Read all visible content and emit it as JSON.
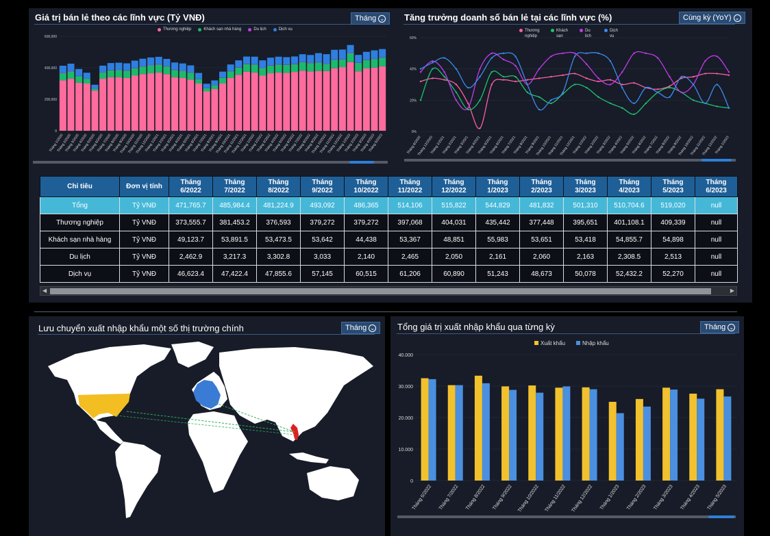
{
  "panel1": {
    "title": "Giá trị bán lẻ theo các lĩnh vực (Tỷ VNĐ)",
    "dropdown": "Tháng",
    "legend": [
      "Thương nghiệp",
      "Khách sạn nhà hàng",
      "Du lịch",
      "Dịch vụ"
    ],
    "colors": [
      "#ff6b9d",
      "#1db96b",
      "#c13fe0",
      "#2f7fe0"
    ]
  },
  "panel2": {
    "title": "Tăng trưởng doanh số bán lẻ tại các lĩnh vực (%)",
    "dropdown": "Cùng kỳ (YoY)",
    "legend": [
      "Thương nghiệp",
      "Khách sạn",
      "Du lịch",
      "Dịch vụ"
    ],
    "colors": [
      "#ff5fa2",
      "#1fc36d",
      "#c33bea",
      "#3d8cf0"
    ]
  },
  "table": {
    "headers": [
      "Chỉ tiêu",
      "Đơn vị tính",
      "Tháng 6/2022",
      "Tháng 7/2022",
      "Tháng 8/2022",
      "Tháng 9/2022",
      "Tháng 10/2022",
      "Tháng 11/2022",
      "Tháng 12/2022",
      "Tháng 1/2023",
      "Tháng 2/2023",
      "Tháng 3/2023",
      "Tháng 4/2023",
      "Tháng 5/2023",
      "Tháng 6/2023"
    ],
    "rows": [
      [
        "Tổng",
        "Tỷ VNĐ",
        "471,765.7",
        "485,984.4",
        "481,224.9",
        "493,092",
        "486,365",
        "514,106",
        "515,822",
        "544,829",
        "481,832",
        "501,310",
        "510,704.6",
        "519,020",
        "null"
      ],
      [
        "Thương nghiệp",
        "Tỷ VNĐ",
        "373,555.7",
        "381,453.2",
        "376,593",
        "379,272",
        "379,272",
        "397,068",
        "404,031",
        "435,442",
        "377,448",
        "395,651",
        "401,108.1",
        "409,339",
        "null"
      ],
      [
        "Khách sạn nhà hàng",
        "Tỷ VNĐ",
        "49,123.7",
        "53,891.5",
        "53,473.5",
        "53,642",
        "44,438",
        "53,367",
        "48,851",
        "55,983",
        "53,651",
        "53,418",
        "54,855.7",
        "54,898",
        "null"
      ],
      [
        "Du lịch",
        "Tỷ VNĐ",
        "2,462.9",
        "3,217.3",
        "3,302.8",
        "3,033",
        "2,140",
        "2,465",
        "2,050",
        "2,161",
        "2,060",
        "2,163",
        "2,308.5",
        "2,513",
        "null"
      ],
      [
        "Dịch vụ",
        "Tỷ VNĐ",
        "46,623.4",
        "47,422.4",
        "47,855.6",
        "57,145",
        "60,515",
        "61,206",
        "60,890",
        "51,243",
        "48,673",
        "50,078",
        "52,432.2",
        "52,270",
        "null"
      ]
    ]
  },
  "panel3": {
    "title": "Lưu chuyển xuất nhập khẩu một số thị trường chính",
    "dropdown": "Tháng"
  },
  "panel4": {
    "title": "Tổng giá trị xuất nhập khẩu qua từng kỳ",
    "dropdown": "Tháng",
    "legend": [
      "Xuất khẩu",
      "Nhập khẩu"
    ],
    "colors": [
      "#f2c12e",
      "#4a8fe0"
    ]
  },
  "chart_data": [
    {
      "type": "bar",
      "stacked": true,
      "y_ticks": [
        "0",
        "200,000",
        "400,000",
        "600,000"
      ],
      "ylim": [
        0,
        600000
      ],
      "categories": [
        "Tháng 1/2020",
        "Tháng 2/2020",
        "Tháng 3/2020",
        "Tháng 4/2020",
        "Tháng 5/2020",
        "Tháng 6/2020",
        "Tháng 7/2020",
        "Tháng 8/2020",
        "Tháng 9/2020",
        "Tháng 10/2020",
        "Tháng 11/2020",
        "Tháng 12/2020",
        "Tháng 1/2021",
        "Tháng 2/2021",
        "Tháng 3/2021",
        "Tháng 4/2021",
        "Tháng 5/2021",
        "Tháng 6/2021",
        "Tháng 7/2021",
        "Tháng 8/2021",
        "Tháng 9/2021",
        "Tháng 10/2021",
        "Tháng 11/2021",
        "Tháng 12/2021",
        "Tháng 1/2022",
        "Tháng 2/2022",
        "Tháng 3/2022",
        "Tháng 4/2022",
        "Tháng 5/2022",
        "Tháng 6/2022",
        "Tháng 7/2022",
        "Tháng 8/2022",
        "Tháng 9/2022",
        "Tháng 10/2022",
        "Tháng 11/2022",
        "Tháng 12/2022",
        "Tháng 1/2023",
        "Tháng 2/2023",
        "Tháng 3/2023",
        "Tháng 4/2023",
        "Tháng 5/2023"
      ],
      "series": [
        {
          "name": "Thương nghiệp",
          "values": [
            320000,
            330000,
            305000,
            300000,
            255000,
            330000,
            340000,
            340000,
            335000,
            350000,
            360000,
            365000,
            370000,
            360000,
            340000,
            335000,
            325000,
            300000,
            250000,
            265000,
            300000,
            335000,
            355000,
            375000,
            370000,
            350000,
            365000,
            370000,
            368000,
            373556,
            381453,
            376593,
            379272,
            379272,
            397068,
            404031,
            435442,
            377448,
            395651,
            401108,
            409339
          ]
        },
        {
          "name": "Khách sạn nhà hàng",
          "values": [
            45000,
            47000,
            42000,
            30000,
            12000,
            40000,
            44000,
            45000,
            46000,
            47000,
            48000,
            50000,
            50000,
            48000,
            46000,
            45000,
            44000,
            28000,
            20000,
            24000,
            36000,
            42000,
            46000,
            48000,
            50000,
            48000,
            49000,
            50000,
            50000,
            49124,
            53892,
            53474,
            53642,
            44438,
            53367,
            48851,
            55983,
            53651,
            53418,
            54856,
            54898
          ]
        },
        {
          "name": "Du lịch",
          "values": [
            3000,
            3000,
            2000,
            500,
            300,
            1500,
            2000,
            2200,
            2200,
            2400,
            2500,
            2600,
            2600,
            2500,
            2500,
            2500,
            2300,
            1000,
            500,
            700,
            1500,
            2000,
            2200,
            2300,
            2400,
            2400,
            2400,
            2400,
            2400,
            2463,
            3217,
            3303,
            3033,
            2140,
            2465,
            2050,
            2161,
            2060,
            2163,
            2309,
            2513
          ]
        },
        {
          "name": "Dịch vụ",
          "values": [
            45000,
            46000,
            43000,
            38000,
            25000,
            42000,
            44000,
            45000,
            45000,
            46000,
            47000,
            48000,
            47000,
            46000,
            45000,
            45000,
            44000,
            38000,
            28000,
            30000,
            38000,
            42000,
            44000,
            46000,
            48000,
            47000,
            48000,
            48000,
            47000,
            46623,
            47422,
            47856,
            57145,
            60515,
            61206,
            60890,
            51243,
            48673,
            50078,
            52432,
            52270
          ]
        }
      ]
    },
    {
      "type": "line",
      "y_ticks": [
        "0%",
        "20%",
        "40%",
        "60%"
      ],
      "ylim": [
        0,
        60
      ],
      "categories": [
        "Tháng 6/2020",
        "Tháng 12/2020",
        "Tháng 1/2021",
        "Tháng 2/2021",
        "Tháng 3/2021",
        "Tháng 4/2021",
        "Tháng 5/2021",
        "Tháng 6/2021",
        "Tháng 7/2021",
        "Tháng 8/2021",
        "Tháng 9/2021",
        "Tháng 10/2021",
        "Tháng 11/2021",
        "Tháng 12/2021",
        "Tháng 1/2022",
        "Tháng 2/2022",
        "Tháng 3/2022",
        "Tháng 4/2022",
        "Tháng 5/2022",
        "Tháng 6/2022",
        "Tháng 7/2022",
        "Tháng 8/2022",
        "Tháng 9/2022",
        "Tháng 10/2022",
        "Tháng 11/2022",
        "Tháng 12/2022",
        "Tháng 1/2023"
      ],
      "series": [
        {
          "name": "Thương nghiệp",
          "values": [
            32,
            34,
            33,
            30,
            18,
            2,
            30,
            33,
            32,
            33,
            34,
            35,
            36,
            37,
            34,
            32,
            33,
            30,
            31,
            28,
            27,
            29,
            34,
            35,
            37,
            37,
            36
          ]
        },
        {
          "name": "Khách sạn",
          "values": [
            20,
            40,
            35,
            25,
            14,
            20,
            38,
            35,
            35,
            25,
            22,
            18,
            24,
            30,
            28,
            22,
            18,
            15,
            11,
            18,
            25,
            28,
            25,
            20,
            18,
            16,
            15
          ]
        },
        {
          "name": "Du lịch",
          "values": [
            38,
            45,
            38,
            20,
            15,
            40,
            50,
            46,
            42,
            30,
            40,
            48,
            50,
            50,
            43,
            34,
            30,
            38,
            50,
            50,
            47,
            35,
            25,
            30,
            45,
            48,
            38
          ]
        },
        {
          "name": "Dịch vụ",
          "values": [
            40,
            44,
            47,
            40,
            28,
            35,
            47,
            50,
            48,
            30,
            14,
            20,
            25,
            48,
            50,
            50,
            45,
            28,
            18,
            28,
            25,
            22,
            35,
            30,
            18,
            30,
            15
          ]
        }
      ]
    },
    {
      "type": "bar",
      "y_ticks": [
        "0",
        "10.000",
        "20.000",
        "30.000",
        "40.000"
      ],
      "ylim": [
        0,
        40000
      ],
      "categories": [
        "Tháng 6/2022",
        "Tháng 7/2022",
        "Tháng 8/2022",
        "Tháng 9/2022",
        "Tháng 10/2022",
        "Tháng 11/2022",
        "Tháng 12/2022",
        "Tháng 1/2023",
        "Tháng 2/2023",
        "Tháng 3/2023",
        "Tháng 4/2023",
        "Tháng 5/2023"
      ],
      "series": [
        {
          "name": "Xuất khẩu",
          "values": [
            32500,
            30300,
            33300,
            29900,
            30200,
            29500,
            29600,
            25000,
            25900,
            29500,
            27600,
            29000
          ]
        },
        {
          "name": "Nhập khẩu",
          "values": [
            32200,
            30300,
            30900,
            28800,
            27900,
            29900,
            29000,
            21400,
            23500,
            28900,
            26000,
            26700
          ]
        }
      ]
    }
  ]
}
